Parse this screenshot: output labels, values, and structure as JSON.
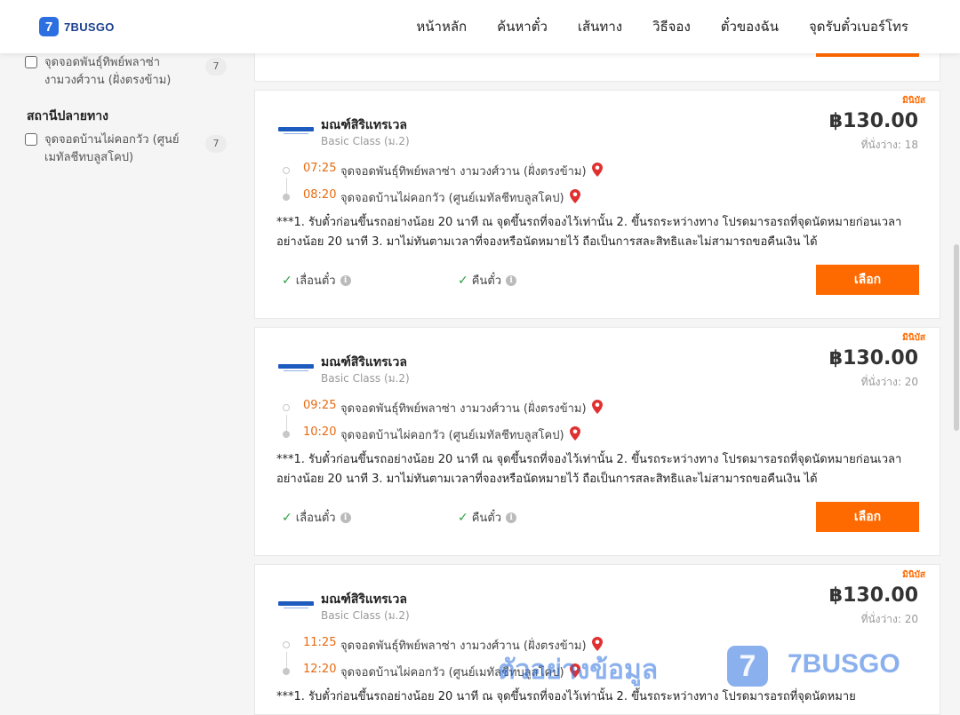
{
  "header": {
    "logo_badge": "7",
    "logo_text": "7BUSGO",
    "nav": [
      "หน้าหลัก",
      "ค้นหาตั๋ว",
      "เส้นทาง",
      "วิธีจอง",
      "ตั๋วของฉัน",
      "จุดรับตั๋วเบอร์โทร"
    ]
  },
  "sidebar": {
    "departure_filter": {
      "label": "จุดจอดพันธุ์ทิพย์พลาซ่า งามวงศ์วาน (ฝั่งตรงข้าม)",
      "count": "7"
    },
    "arrival_title": "สถานีปลายทาง",
    "arrival_filter": {
      "label": "จุดจอดบ้านไผ่คอกวัว (ศูนย์เมทัลชีทบลูสโคป)",
      "count": "7"
    }
  },
  "trips": [
    {
      "tag": "มินิบัส",
      "operator": "มณฑ์สิริแทรเวล",
      "class": "Basic Class (ม.2)",
      "price": "฿130.00",
      "seats": "ที่นั่งว่าง: 18",
      "dep_time": "07:25",
      "dep_stop": "จุดจอดพันธุ์ทิพย์พลาซ่า งามวงศ์วาน (ฝั่งตรงข้าม)",
      "arr_time": "08:20",
      "arr_stop": "จุดจอดบ้านไผ่คอกวัว (ศูนย์เมทัลชีทบลูสโคป)",
      "notes": "***1. รับตั๋วก่อนขึ้นรถอย่างน้อย 20 นาที ณ จุดขึ้นรถที่จองไว้เท่านั้น 2. ขึ้นรถระหว่างทาง โปรดมารอรถที่จุดนัดหมายก่อนเวลาอย่างน้อย 20 นาที 3. มาไม่ทันตามเวลาที่จองหรือนัดหมายไว้ ถือเป็นการสละสิทธิและไม่สามารถขอคืนเงิน ได้",
      "feature1": "เลื่อนตั๋ว",
      "feature2": "คืนตั๋ว",
      "button": "เลือก"
    },
    {
      "tag": "มินิบัส",
      "operator": "มณฑ์สิริแทรเวล",
      "class": "Basic Class (ม.2)",
      "price": "฿130.00",
      "seats": "ที่นั่งว่าง: 20",
      "dep_time": "09:25",
      "dep_stop": "จุดจอดพันธุ์ทิพย์พลาซ่า งามวงศ์วาน (ฝั่งตรงข้าม)",
      "arr_time": "10:20",
      "arr_stop": "จุดจอดบ้านไผ่คอกวัว (ศูนย์เมทัลชีทบลูสโคป)",
      "notes": "***1. รับตั๋วก่อนขึ้นรถอย่างน้อย 20 นาที ณ จุดขึ้นรถที่จองไว้เท่านั้น 2. ขึ้นรถระหว่างทาง โปรดมารอรถที่จุดนัดหมายก่อนเวลาอย่างน้อย 20 นาที 3. มาไม่ทันตามเวลาที่จองหรือนัดหมายไว้ ถือเป็นการสละสิทธิและไม่สามารถขอคืนเงิน ได้",
      "feature1": "เลื่อนตั๋ว",
      "feature2": "คืนตั๋ว",
      "button": "เลือก"
    },
    {
      "tag": "มินิบัส",
      "operator": "มณฑ์สิริแทรเวล",
      "class": "Basic Class (ม.2)",
      "price": "฿130.00",
      "seats": "ที่นั่งว่าง: 20",
      "dep_time": "11:25",
      "dep_stop": "จุดจอดพันธุ์ทิพย์พลาซ่า งามวงศ์วาน (ฝั่งตรงข้าม)",
      "arr_time": "12:20",
      "arr_stop": "จุดจอดบ้านไผ่คอกวัว (ศูนย์เมทัลชีทบลูสโคป)",
      "notes": "***1. รับตั๋วก่อนขึ้นรถอย่างน้อย 20 นาที ณ จุดขึ้นรถที่จองไว้เท่านั้น 2. ขึ้นรถระหว่างทาง โปรดมารอรถที่จุดนัดหมาย",
      "feature1": "",
      "feature2": "",
      "button": ""
    }
  ],
  "watermark": {
    "text": "ตัวอย่างข้อมูล",
    "badge": "7",
    "brand": "7BUSGO"
  },
  "colors": {
    "accent": "#ff6a00",
    "time": "#e86a10",
    "brand": "#2b6fe0",
    "pin": "#e03030",
    "check": "#2e9e3e"
  }
}
